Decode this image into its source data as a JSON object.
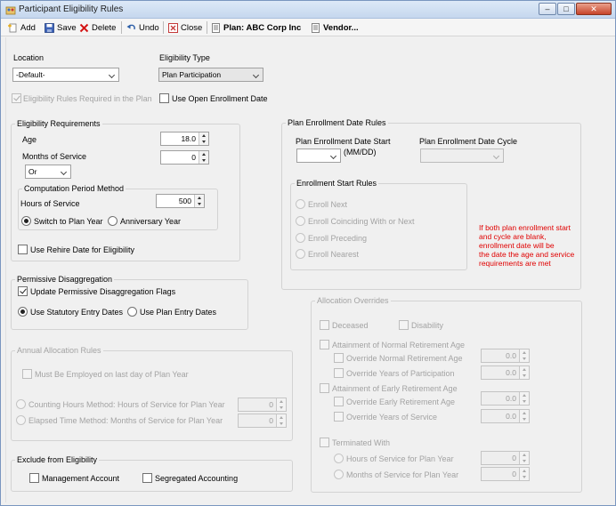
{
  "window": {
    "title": "Participant Eligibility Rules"
  },
  "toolbar": {
    "add": "Add",
    "save": "Save",
    "delete": "Delete",
    "undo": "Undo",
    "close": "Close",
    "plan": "Plan: ABC Corp Inc",
    "vendor": "Vendor..."
  },
  "location": {
    "label": "Location",
    "value": "-Default-"
  },
  "eligibility_type": {
    "label": "Eligibility Type",
    "value": "Plan Participation"
  },
  "rules_required": {
    "label": "Eligibility Rules Required in the Plan"
  },
  "open_enrollment": {
    "label": "Use Open Enrollment Date"
  },
  "requirements": {
    "title": "Eligibility Requirements",
    "age_label": "Age",
    "age_value": "18.0",
    "months_label": "Months of Service",
    "months_value": "0",
    "logic_value": "Or",
    "computation_title": "Computation Period Method",
    "hours_label": "Hours of Service",
    "hours_value": "500",
    "switch_label": "Switch to Plan Year",
    "anniversary_label": "Anniversary Year",
    "rehire_label": "Use Rehire Date for Eligibility"
  },
  "permissive": {
    "title": "Permissive Disaggregation",
    "update_label": "Update Permissive Disaggregation Flags",
    "statutory_label": "Use Statutory Entry Dates",
    "plan_entry_label": "Use Plan Entry Dates"
  },
  "annual": {
    "title": "Annual Allocation Rules",
    "employed_label": "Must Be Employed on last day of Plan Year",
    "counting_label": "Counting Hours Method:  Hours of Service for Plan Year",
    "counting_value": "0",
    "elapsed_label": "Elapsed Time Method: Months of Service for Plan Year",
    "elapsed_value": "0"
  },
  "exclude": {
    "title": "Exclude from Eligibility",
    "management_label": "Management Account",
    "segregated_label": "Segregated Accounting"
  },
  "enrollment": {
    "title": "Plan Enrollment Date Rules",
    "start_label": "Plan Enrollment Date Start",
    "mmdd": "(MM/DD)",
    "cycle_label": "Plan Enrollment Date Cycle",
    "start_rules_title": "Enrollment Start Rules",
    "next": "Enroll Next",
    "coinciding": "Enroll Coinciding With or Next",
    "preceding": "Enroll Preceding",
    "nearest": "Enroll Nearest",
    "note": [
      "If both plan enrollment start",
      "and cycle are blank,",
      "enrollment date will be",
      "the date the age and service",
      "requirements are met"
    ]
  },
  "overrides": {
    "title": "Allocation Overrides",
    "deceased": "Deceased",
    "disability": "Disability",
    "normal_title": "Attainment of Normal Retirement Age",
    "normal_age_label": "Override Normal Retirement Age",
    "normal_age_value": "0.0",
    "normal_years_label": "Override Years of Participation",
    "normal_years_value": "0.0",
    "early_title": "Attainment of Early Retirement Age",
    "early_age_label": "Override Early Retirement Age",
    "early_age_value": "0.0",
    "early_years_label": "Override Years of Service",
    "early_years_value": "0.0",
    "terminated_title": "Terminated With",
    "term_hours_label": "Hours of Service for Plan Year",
    "term_hours_value": "0",
    "term_months_label": "Months of Service for Plan Year",
    "term_months_value": "0"
  },
  "colors": {
    "note_red": "#e00000",
    "titlebar": "#c5d7ee"
  }
}
